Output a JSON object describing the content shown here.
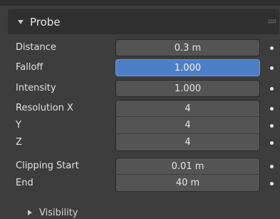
{
  "panel": {
    "title": "Probe",
    "rows": [
      {
        "label": "Distance",
        "value": "0.3 m"
      },
      {
        "label": "Falloff",
        "value": "1.000"
      },
      {
        "label": "Intensity",
        "value": "1.000"
      },
      {
        "label": "Resolution X",
        "value": "4"
      },
      {
        "label": "Y",
        "value": "4"
      },
      {
        "label": "Z",
        "value": "4"
      },
      {
        "label": "Clipping Start",
        "value": "0.01 m"
      },
      {
        "label": "End",
        "value": "40 m"
      }
    ],
    "subpanel": {
      "label": "Visibility"
    }
  },
  "colors": {
    "active_field": "#4d7fc7",
    "field": "#545454",
    "panel_bg": "#3d3d3d",
    "header_bg": "#303030"
  }
}
